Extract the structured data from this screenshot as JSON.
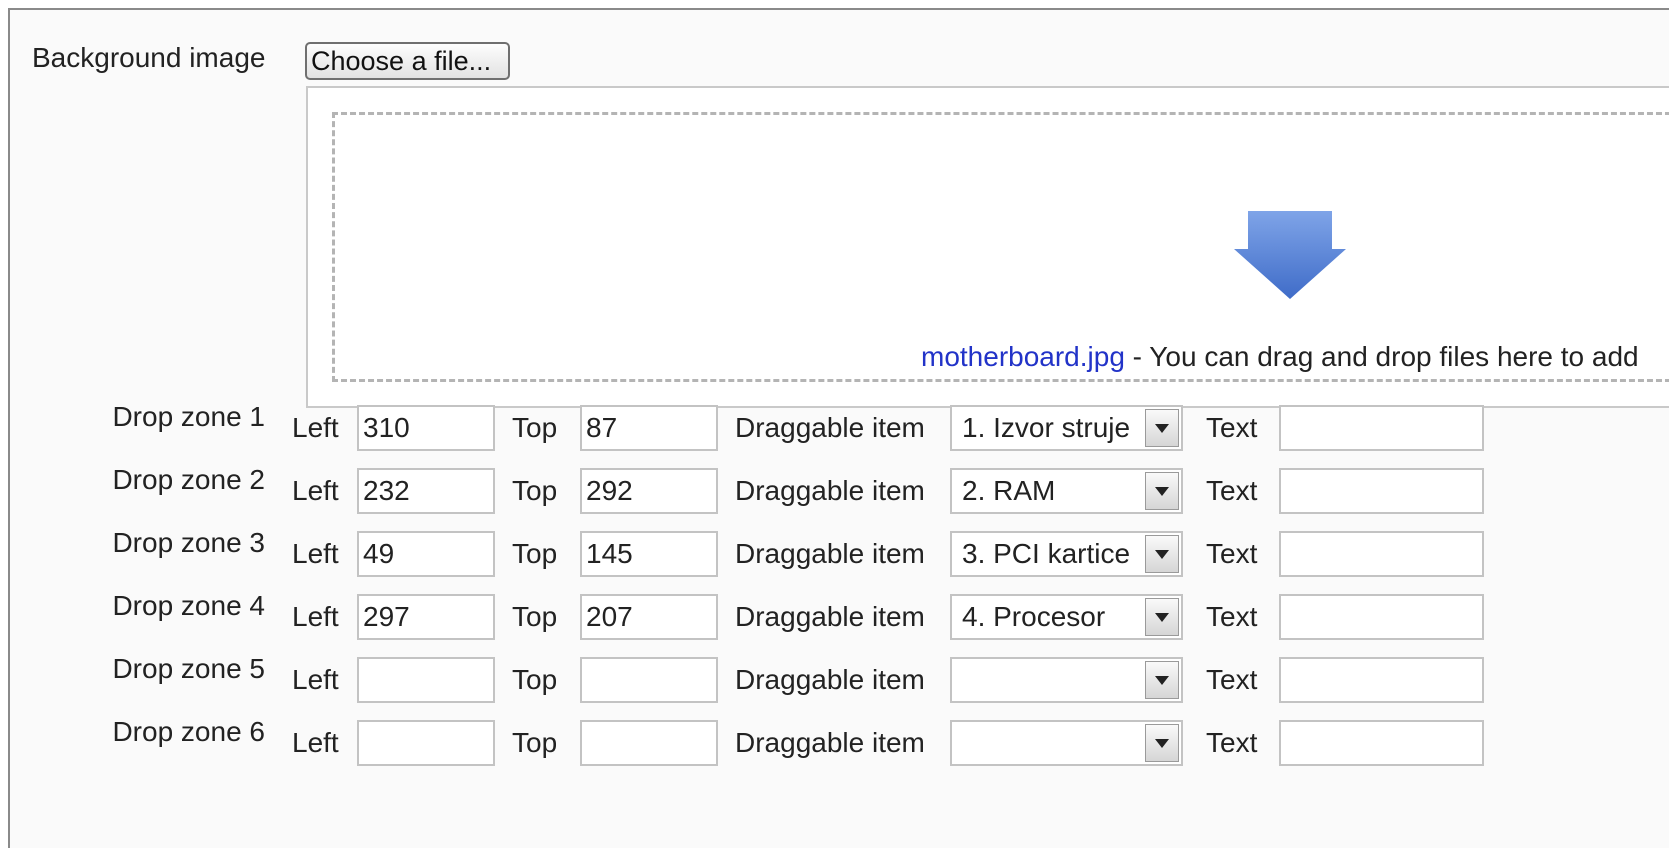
{
  "background": {
    "label": "Background image",
    "choose_button": "Choose a file...",
    "file_name": "motherboard.jpg",
    "drop_message": " - You can drag and drop files here to add"
  },
  "labels": {
    "left": "Left",
    "top": "Top",
    "draggable_item": "Draggable item",
    "text": "Text"
  },
  "zones": [
    {
      "label": "Drop zone 1",
      "left": "310",
      "top": "87",
      "item": "1. Izvor struje",
      "text": ""
    },
    {
      "label": "Drop zone 2",
      "left": "232",
      "top": "292",
      "item": "2. RAM",
      "text": ""
    },
    {
      "label": "Drop zone 3",
      "left": "49",
      "top": "145",
      "item": "3. PCI kartice",
      "text": ""
    },
    {
      "label": "Drop zone 4",
      "left": "297",
      "top": "207",
      "item": "4. Procesor",
      "text": ""
    },
    {
      "label": "Drop zone 5",
      "left": "",
      "top": "",
      "item": "",
      "text": ""
    },
    {
      "label": "Drop zone 6",
      "left": "",
      "top": "",
      "item": "",
      "text": ""
    }
  ],
  "icons": {
    "drop_arrow": "down-arrow-icon",
    "select_arrow": "chevron-down-icon"
  },
  "colors": {
    "arrow": "#4f7fd6",
    "link": "#2233c8"
  }
}
